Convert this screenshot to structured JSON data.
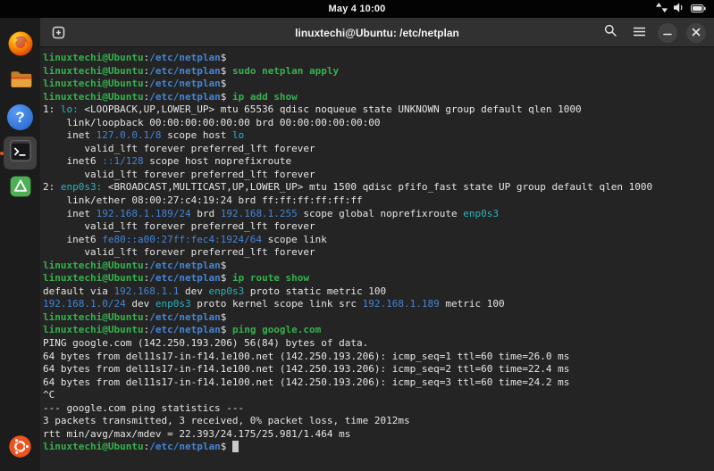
{
  "palette": {
    "topbar_bg": "#030303",
    "dock_bg": "#1c1c1c",
    "header_bg": "#313131",
    "terminal_bg": "#242424",
    "fg": "#e6e6e4",
    "green": "#36b14d",
    "blue": "#4585d6",
    "cyan": "#2ab3bd",
    "accent": "#e95420"
  },
  "topbar": {
    "clock": "May 4 10:00",
    "tray_icons": [
      "network-arrows-icon",
      "volume-icon",
      "battery-icon"
    ]
  },
  "dock": {
    "items": [
      {
        "name": "firefox",
        "label": "Firefox"
      },
      {
        "name": "files",
        "label": "Files"
      },
      {
        "name": "help",
        "label": "Help",
        "glyph": "?"
      },
      {
        "name": "terminal",
        "label": "Terminal",
        "active": true
      },
      {
        "name": "software",
        "label": "Software"
      }
    ],
    "bottom": {
      "name": "ubuntu-logo",
      "label": "Ubuntu"
    }
  },
  "window": {
    "title": "linuxtechi@Ubuntu: /etc/netplan",
    "buttons": [
      "new-tab",
      "search",
      "menu",
      "minimize",
      "close"
    ]
  },
  "terminal": {
    "lines": [
      [
        {
          "t": "linuxtechi@Ubuntu",
          "c": "g"
        },
        {
          "t": ":",
          "c": "w"
        },
        {
          "t": "/etc/netplan",
          "c": "bb"
        },
        {
          "t": "$ ",
          "c": "w"
        }
      ],
      [
        {
          "t": "linuxtechi@Ubuntu",
          "c": "g"
        },
        {
          "t": ":",
          "c": "w"
        },
        {
          "t": "/etc/netplan",
          "c": "bb"
        },
        {
          "t": "$ ",
          "c": "w"
        },
        {
          "t": "sudo netplan apply",
          "c": "g"
        }
      ],
      [
        {
          "t": "linuxtechi@Ubuntu",
          "c": "g"
        },
        {
          "t": ":",
          "c": "w"
        },
        {
          "t": "/etc/netplan",
          "c": "bb"
        },
        {
          "t": "$ ",
          "c": "w"
        }
      ],
      [
        {
          "t": "linuxtechi@Ubuntu",
          "c": "g"
        },
        {
          "t": ":",
          "c": "w"
        },
        {
          "t": "/etc/netplan",
          "c": "bb"
        },
        {
          "t": "$ ",
          "c": "w"
        },
        {
          "t": "ip add show",
          "c": "g"
        }
      ],
      [
        {
          "t": "1: ",
          "c": "w"
        },
        {
          "t": "lo: ",
          "c": "c"
        },
        {
          "t": "<LOOPBACK,UP,LOWER_UP> mtu 65536 qdisc noqueue state UNKNOWN group default qlen 1000",
          "c": "w"
        }
      ],
      [
        {
          "t": "    link/loopback 00:00:00:00:00:00 brd 00:00:00:00:00:00",
          "c": "w"
        }
      ],
      [
        {
          "t": "    inet ",
          "c": "w"
        },
        {
          "t": "127.0.0.1/8",
          "c": "b"
        },
        {
          "t": " scope host ",
          "c": "w"
        },
        {
          "t": "lo",
          "c": "c"
        }
      ],
      [
        {
          "t": "       valid_lft forever preferred_lft forever",
          "c": "w"
        }
      ],
      [
        {
          "t": "    inet6 ",
          "c": "w"
        },
        {
          "t": "::1/128",
          "c": "b"
        },
        {
          "t": " scope host noprefixroute",
          "c": "w"
        }
      ],
      [
        {
          "t": "       valid_lft forever preferred_lft forever",
          "c": "w"
        }
      ],
      [
        {
          "t": "2: ",
          "c": "w"
        },
        {
          "t": "enp0s3: ",
          "c": "c"
        },
        {
          "t": "<BROADCAST,MULTICAST,UP,LOWER_UP> mtu 1500 qdisc pfifo_fast state UP group default qlen 1000",
          "c": "w"
        }
      ],
      [
        {
          "t": "    link/ether 08:00:27:c4:19:24 brd ff:ff:ff:ff:ff:ff",
          "c": "w"
        }
      ],
      [
        {
          "t": "    inet ",
          "c": "w"
        },
        {
          "t": "192.168.1.189/24",
          "c": "b"
        },
        {
          "t": " brd ",
          "c": "w"
        },
        {
          "t": "192.168.1.255",
          "c": "b"
        },
        {
          "t": " scope global noprefixroute ",
          "c": "w"
        },
        {
          "t": "enp0s3",
          "c": "c"
        }
      ],
      [
        {
          "t": "       valid_lft forever preferred_lft forever",
          "c": "w"
        }
      ],
      [
        {
          "t": "    inet6 ",
          "c": "w"
        },
        {
          "t": "fe80::a00:27ff:fec4:1924/64",
          "c": "b"
        },
        {
          "t": " scope link",
          "c": "w"
        }
      ],
      [
        {
          "t": "       valid_lft forever preferred_lft forever",
          "c": "w"
        }
      ],
      [
        {
          "t": "linuxtechi@Ubuntu",
          "c": "g"
        },
        {
          "t": ":",
          "c": "w"
        },
        {
          "t": "/etc/netplan",
          "c": "bb"
        },
        {
          "t": "$ ",
          "c": "w"
        }
      ],
      [
        {
          "t": "linuxtechi@Ubuntu",
          "c": "g"
        },
        {
          "t": ":",
          "c": "w"
        },
        {
          "t": "/etc/netplan",
          "c": "bb"
        },
        {
          "t": "$ ",
          "c": "w"
        },
        {
          "t": "ip route show",
          "c": "g"
        }
      ],
      [
        {
          "t": "default via ",
          "c": "w"
        },
        {
          "t": "192.168.1.1",
          "c": "b"
        },
        {
          "t": " dev ",
          "c": "w"
        },
        {
          "t": "enp0s3",
          "c": "c"
        },
        {
          "t": " proto static metric 100",
          "c": "w"
        }
      ],
      [
        {
          "t": "192.168.1.0/24",
          "c": "b"
        },
        {
          "t": " dev ",
          "c": "w"
        },
        {
          "t": "enp0s3",
          "c": "c"
        },
        {
          "t": " proto kernel scope link src ",
          "c": "w"
        },
        {
          "t": "192.168.1.189",
          "c": "b"
        },
        {
          "t": " metric 100",
          "c": "w"
        }
      ],
      [
        {
          "t": "linuxtechi@Ubuntu",
          "c": "g"
        },
        {
          "t": ":",
          "c": "w"
        },
        {
          "t": "/etc/netplan",
          "c": "bb"
        },
        {
          "t": "$ ",
          "c": "w"
        }
      ],
      [
        {
          "t": "linuxtechi@Ubuntu",
          "c": "g"
        },
        {
          "t": ":",
          "c": "w"
        },
        {
          "t": "/etc/netplan",
          "c": "bb"
        },
        {
          "t": "$ ",
          "c": "w"
        },
        {
          "t": "ping google.com",
          "c": "g"
        }
      ],
      [
        {
          "t": "PING google.com (142.250.193.206) 56(84) bytes of data.",
          "c": "w"
        }
      ],
      [
        {
          "t": "64 bytes from del11s17-in-f14.1e100.net (142.250.193.206): icmp_seq=1 ttl=60 time=26.0 ms",
          "c": "w"
        }
      ],
      [
        {
          "t": "64 bytes from del11s17-in-f14.1e100.net (142.250.193.206): icmp_seq=2 ttl=60 time=22.4 ms",
          "c": "w"
        }
      ],
      [
        {
          "t": "64 bytes from del11s17-in-f14.1e100.net (142.250.193.206): icmp_seq=3 ttl=60 time=24.2 ms",
          "c": "w"
        }
      ],
      [
        {
          "t": "^C",
          "c": "w"
        }
      ],
      [
        {
          "t": "--- google.com ping statistics ---",
          "c": "w"
        }
      ],
      [
        {
          "t": "3 packets transmitted, 3 received, 0% packet loss, time 2012ms",
          "c": "w"
        }
      ],
      [
        {
          "t": "rtt min/avg/max/mdev = 22.393/24.175/25.981/1.464 ms",
          "c": "w"
        }
      ],
      [
        {
          "t": "linuxtechi@Ubuntu",
          "c": "g"
        },
        {
          "t": ":",
          "c": "w"
        },
        {
          "t": "/etc/netplan",
          "c": "bb"
        },
        {
          "t": "$ ",
          "c": "w"
        },
        {
          "t": " ",
          "c": "cur"
        }
      ]
    ]
  }
}
